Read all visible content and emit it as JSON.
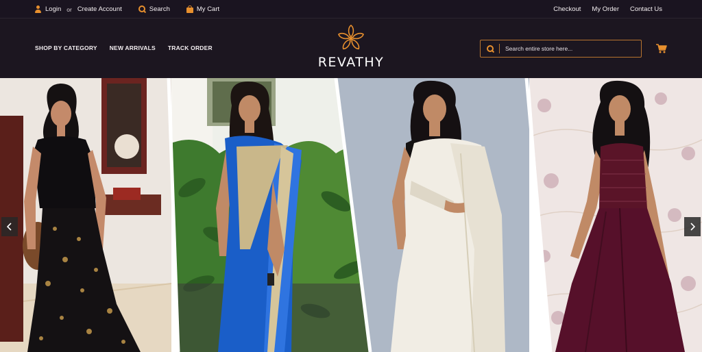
{
  "topbar": {
    "login": "Login",
    "or": "or",
    "create_account": "Create Account",
    "search": "Search",
    "cart": "My Cart",
    "right_links": [
      "Checkout",
      "My Order",
      "Contact Us"
    ]
  },
  "nav": {
    "items": [
      "SHOP BY CATEGORY",
      "NEW ARRIVALS",
      "TRACK ORDER"
    ]
  },
  "brand": {
    "name": "REVATHY"
  },
  "search": {
    "placeholder": "Search entire store here..."
  },
  "hero": {
    "slides": [
      "Black sequined lehenga outfit",
      "Blue silk saree",
      "White kasavu saree",
      "Maroon sequined gown"
    ]
  },
  "colors": {
    "accent": "#e8902e",
    "header_bg": "#1c1620",
    "topbar_bg": "#1a1420"
  },
  "icons": {
    "user": "user-icon",
    "search": "search-icon",
    "bag": "bag-icon",
    "cart": "cart-icon",
    "logo": "flower-logo-icon",
    "prev": "chevron-left-icon",
    "next": "chevron-right-icon"
  }
}
